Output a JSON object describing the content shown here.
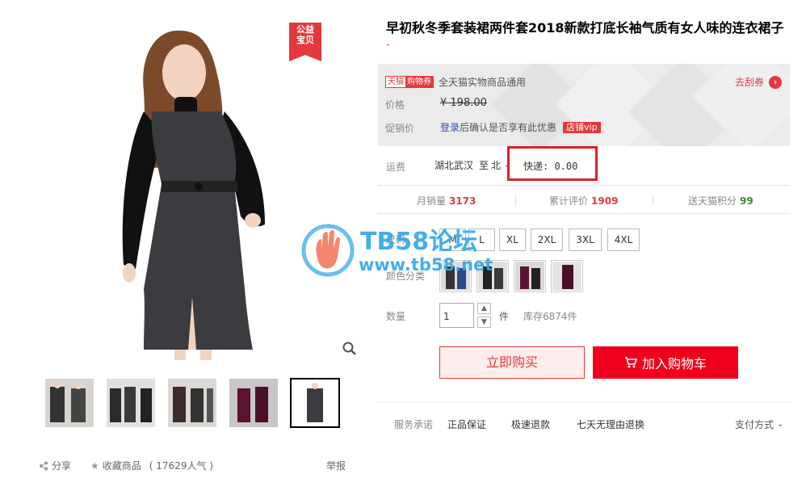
{
  "product": {
    "title": "早初秋冬季套装裙两件套2018新款打底长袖气质有女人味的连衣裙子",
    "subtitle": "-",
    "badge": "公益\n宝贝"
  },
  "price_box": {
    "tmall_a": "天猫",
    "tmall_b": "购物券",
    "coupon_text": "全天猫实物商品通用",
    "coupon_link": "去刮券",
    "price_label": "价格",
    "price_value": "¥ 198.00",
    "promo_label": "促销价",
    "promo_login": "登录",
    "promo_text": "后确认是否享有此优惠",
    "vip_tag": "店铺vip"
  },
  "shipping": {
    "label": "运费",
    "from": "湖北武汉",
    "to_prefix": "至",
    "to": "北京",
    "fee": "快递: 0.00"
  },
  "stats": {
    "monthly_label": "月销量",
    "monthly_value": "3173",
    "reviews_label": "累计评价",
    "reviews_value": "1909",
    "points_label": "送天猫积分",
    "points_value": "99"
  },
  "size": {
    "label": "尺码",
    "options": [
      "M",
      "L",
      "XL",
      "2XL",
      "3XL",
      "4XL"
    ]
  },
  "color": {
    "label": "颜色分类"
  },
  "quantity": {
    "label": "数量",
    "value": "1",
    "unit": "件",
    "stock": "库存6874件"
  },
  "buttons": {
    "buy_now": "立即购买",
    "add_cart": "加入购物车"
  },
  "service": {
    "label": "服务承诺",
    "items": [
      "正品保证",
      "极速退款",
      "七天无理由退换"
    ],
    "pay": "支付方式"
  },
  "actions": {
    "share": "分享",
    "favorite": "收藏商品",
    "popularity": "( 17629人气 )",
    "report": "举报"
  },
  "watermark": {
    "line1": "TB58论坛",
    "line2": "www.tb58.net"
  },
  "colors": {
    "accent": "#e4393c",
    "cart": "#f0001c",
    "highlight": "#e01f2d"
  }
}
